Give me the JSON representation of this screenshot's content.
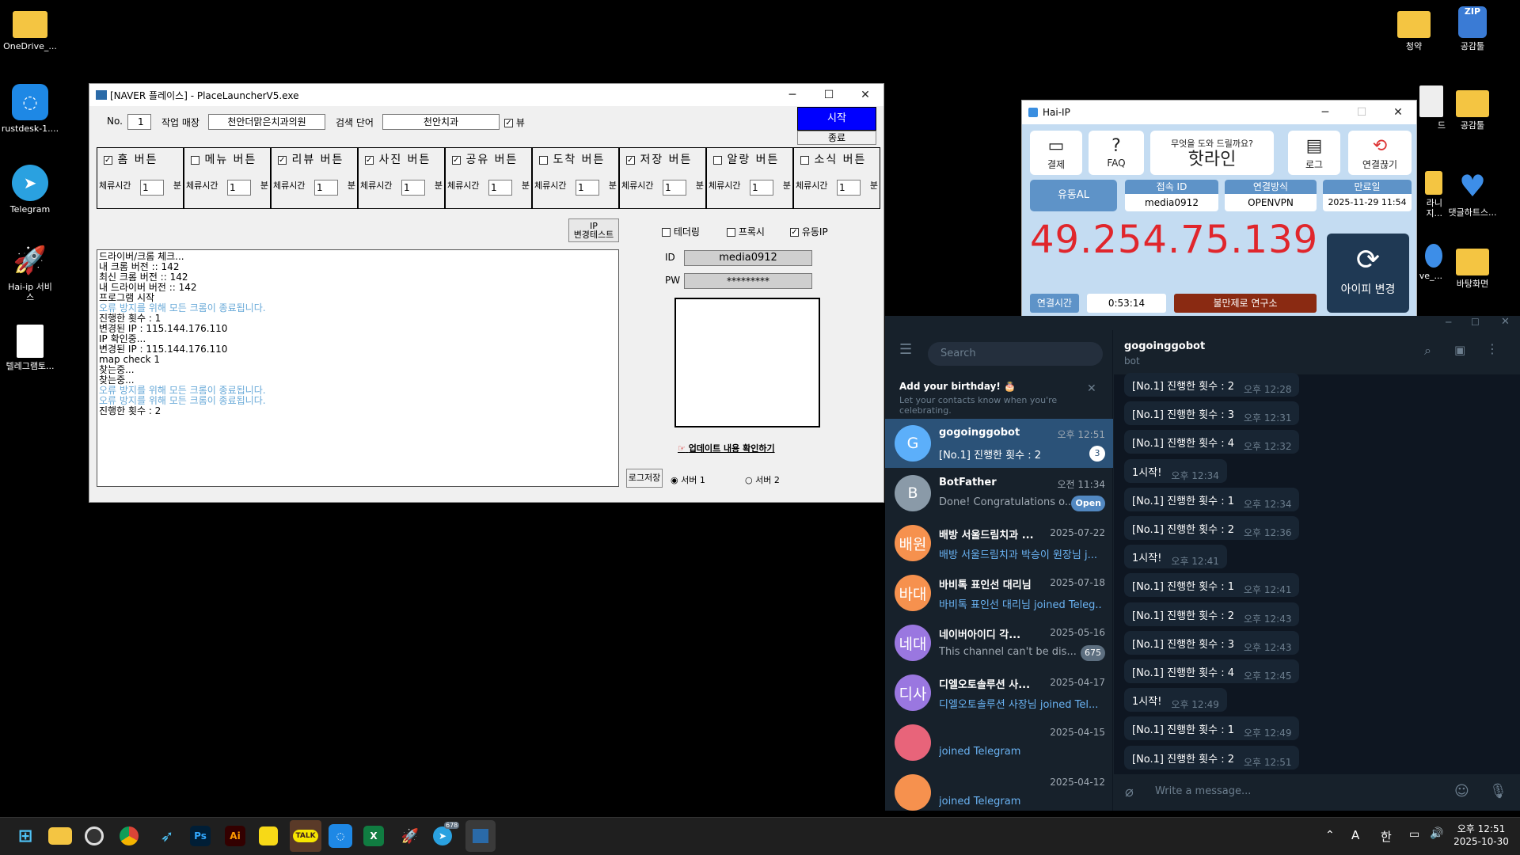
{
  "desktop": {
    "left_icons": [
      {
        "label": "OneDrive_...",
        "icon": "folder-icon"
      },
      {
        "label": "rustdesk-1....",
        "icon": "rustdesk-icon"
      },
      {
        "label": "Telegram",
        "icon": "telegram-icon"
      },
      {
        "label": "Hai-ip 서비스",
        "icon": "rocket-icon"
      },
      {
        "label": "텔레그램토...",
        "icon": "document-icon"
      }
    ],
    "right_icons": [
      {
        "label": "청약",
        "icon": "folder-icon"
      },
      {
        "label": "공감툴",
        "icon": "zip-icon",
        "badge": "ZIP"
      },
      {
        "label": "공감툴",
        "icon": "folder-icon"
      },
      {
        "label": "드",
        "icon": "document-icon"
      },
      {
        "label": "댓글하트스...",
        "icon": "heart-icon"
      },
      {
        "label": "바탕화면",
        "icon": "folder-icon"
      },
      {
        "label": "라니 지...",
        "icon": "folder-icon"
      },
      {
        "label": "ve_...",
        "icon": "folder-icon"
      }
    ]
  },
  "launcher": {
    "title": "[NAVER 플레이스] - PlaceLauncherV5.exe",
    "no_label": "No.",
    "no_value": "1",
    "store_label": "작업 매장",
    "store_value": "천안더맑은치과의원",
    "search_label": "검색 단어",
    "search_value": "천안치과",
    "view_label": "뷰",
    "start_label": "시작",
    "stop_label": "종료",
    "buttons": [
      {
        "label": "홈 버튼",
        "checked": true,
        "stay_label": "체류시간",
        "stay": "1",
        "unit": "분"
      },
      {
        "label": "메뉴 버튼",
        "checked": false,
        "stay_label": "체류시간",
        "stay": "1",
        "unit": "분"
      },
      {
        "label": "리뷰 버튼",
        "checked": true,
        "stay_label": "체류시간",
        "stay": "1",
        "unit": "분"
      },
      {
        "label": "사진 버튼",
        "checked": true,
        "stay_label": "체류시간",
        "stay": "1",
        "unit": "분"
      },
      {
        "label": "공유 버튼",
        "checked": true,
        "stay_label": "체류시간",
        "stay": "1",
        "unit": "분"
      },
      {
        "label": "도착 버튼",
        "checked": false,
        "stay_label": "체류시간",
        "stay": "1",
        "unit": "분"
      },
      {
        "label": "저장 버튼",
        "checked": true,
        "stay_label": "체류시간",
        "stay": "1",
        "unit": "분"
      },
      {
        "label": "알랑 버튼",
        "checked": false,
        "stay_label": "체류시간",
        "stay": "1",
        "unit": "분"
      },
      {
        "label": "소식 버튼",
        "checked": false,
        "stay_label": "체류시간",
        "stay": "1",
        "unit": "분"
      }
    ],
    "ip_test_line1": "IP",
    "ip_test_line2": "변경테스트",
    "tethering_label": "테더링",
    "proxy_label": "프록시",
    "dynamic_ip_label": "유동IP",
    "id_label": "ID",
    "id_value": "media0912",
    "pw_label": "PW",
    "pw_value": "*********",
    "update_link": "업데이트 내용 확인하기",
    "log_save": "로그저장",
    "server1": "서버 1",
    "server2": "서버 2",
    "log": [
      {
        "text": "드라이버/크롬 체크...",
        "blue": false
      },
      {
        "text": "내 크롬 버전 :: 142",
        "blue": false
      },
      {
        "text": "최신 크롬 버전 :: 142",
        "blue": false
      },
      {
        "text": "내 드라이버 버전 :: 142",
        "blue": false
      },
      {
        "text": "프로그램 시작",
        "blue": false
      },
      {
        "text": "오류 방지를 위해 모든 크롬이 종료됩니다.",
        "blue": true
      },
      {
        "text": "진행한 횟수 : 1",
        "blue": false
      },
      {
        "text": "변경된 IP : 115.144.176.110",
        "blue": false
      },
      {
        "text": "IP 확인중...",
        "blue": false
      },
      {
        "text": "변경된 IP : 115.144.176.110",
        "blue": false
      },
      {
        "text": "map check 1",
        "blue": false
      },
      {
        "text": "찾는중...",
        "blue": false
      },
      {
        "text": "찾는중...",
        "blue": false
      },
      {
        "text": "오류 방지를 위해 모든 크롬이 종료됩니다.",
        "blue": true
      },
      {
        "text": "오류 방지를 위해 모든 크롬이 종료됩니다.",
        "blue": true
      },
      {
        "text": "진행한 횟수 : 2",
        "blue": false
      }
    ]
  },
  "haiip": {
    "title": "Hai-IP",
    "tile_payment": "결제",
    "tile_faq": "FAQ",
    "help_line1": "무엇을 도와 드릴까요?",
    "help_line2": "핫라인",
    "tile_log": "로그",
    "tile_disconnect": "연결끊기",
    "dynamic_al": "유동AL",
    "access_id_label": "접속 ID",
    "access_id": "media0912",
    "conn_method_label": "연결방식",
    "conn_method": "OPENVPN",
    "expiry_label": "만료일",
    "expiry": "2025-11-29 11:54",
    "ip": "49.254.75.139",
    "conn_time_label": "연결시간",
    "conn_time": "0:53:14",
    "complaint": "불만제로 연구소",
    "change_ip": "아이피 변경"
  },
  "telegram": {
    "search_placeholder": "Search",
    "birthday_title": "Add your birthday! 🎂",
    "birthday_sub": "Let your contacts know when you're celebrating.",
    "chats": [
      {
        "name": "gogoinggobot",
        "date": "오후 12:51",
        "preview": "[No.1] 진행한 횟수 : 2",
        "badge": "3",
        "avatar": "G",
        "color": "#5caffa",
        "active": true
      },
      {
        "name": "BotFather",
        "date": "오전 11:34",
        "preview": "Done! Congratulations o...",
        "badge": "Open",
        "avatar": "B",
        "color": "#8a9aa8",
        "active": false
      },
      {
        "name": "배방 서울드림치과 ...",
        "date": "2025-07-22",
        "preview": "배방 서울드림치과 박승이 원장님 j...",
        "badge": "",
        "avatar": "배원",
        "color": "#f6914e",
        "active": false
      },
      {
        "name": "바비톡 표인선 대리님",
        "date": "2025-07-18",
        "preview": "바비톡 표인선 대리님 joined Teleg...",
        "badge": "",
        "avatar": "바대",
        "color": "#f6914e",
        "active": false
      },
      {
        "name": "네이버아이디 각...",
        "date": "2025-05-16",
        "preview": "This channel can't be dis...",
        "badge": "675",
        "avatar": "네대",
        "color": "#9a77e0",
        "active": false
      },
      {
        "name": "디엘오토솔루션 사...",
        "date": "2025-04-17",
        "preview": "디엘오토솔루션 사장님 joined Tel...",
        "badge": "",
        "avatar": "디사",
        "color": "#9a77e0",
        "active": false
      },
      {
        "name": "",
        "date": "2025-04-15",
        "preview": "joined Telegram",
        "badge": "",
        "avatar": "",
        "color": "#e8647a",
        "active": false
      },
      {
        "name": "",
        "date": "2025-04-12",
        "preview": "joined Telegram",
        "badge": "",
        "avatar": "",
        "color": "#f6914e",
        "active": false
      }
    ],
    "chat_title": "gogoinggobot",
    "chat_sub": "bot",
    "messages": [
      {
        "text": "[No.1] 진행한 횟수 : 2",
        "time": "오후 12:28"
      },
      {
        "text": "[No.1] 진행한 횟수 : 3",
        "time": "오후 12:31"
      },
      {
        "text": "[No.1] 진행한 횟수 : 4",
        "time": "오후 12:32"
      },
      {
        "text": "1시작!",
        "time": "오후 12:34"
      },
      {
        "text": "[No.1] 진행한 횟수 : 1",
        "time": "오후 12:34"
      },
      {
        "text": "[No.1] 진행한 횟수 : 2",
        "time": "오후 12:36"
      },
      {
        "text": "1시작!",
        "time": "오후 12:41"
      },
      {
        "text": "[No.1] 진행한 횟수 : 1",
        "time": "오후 12:41"
      },
      {
        "text": "[No.1] 진행한 횟수 : 2",
        "time": "오후 12:43"
      },
      {
        "text": "[No.1] 진행한 횟수 : 3",
        "time": "오후 12:43"
      },
      {
        "text": "[No.1] 진행한 횟수 : 4",
        "time": "오후 12:45"
      },
      {
        "text": "1시작!",
        "time": "오후 12:49"
      },
      {
        "text": "[No.1] 진행한 횟수 : 1",
        "time": "오후 12:49"
      },
      {
        "text": "[No.1] 진행한 횟수 : 2",
        "time": "오후 12:51"
      }
    ],
    "input_placeholder": "Write a message..."
  },
  "taskbar": {
    "apps": [
      "windows-start-icon",
      "file-explorer-icon",
      "obs-icon",
      "chrome-icon",
      "feather-icon",
      "photoshop-icon",
      "illustrator-icon",
      "sticky-notes-icon",
      "kakaotalk-icon",
      "rustdesk-icon",
      "excel-icon",
      "hai-ip-icon",
      "telegram-icon",
      "launcher-icon"
    ],
    "ps": "Ps",
    "ai": "Ai",
    "talk": "TALK",
    "telegram_badge": "678",
    "ime_a": "A",
    "ime_han": "한",
    "time": "오후 12:51",
    "date": "2025-10-30"
  }
}
